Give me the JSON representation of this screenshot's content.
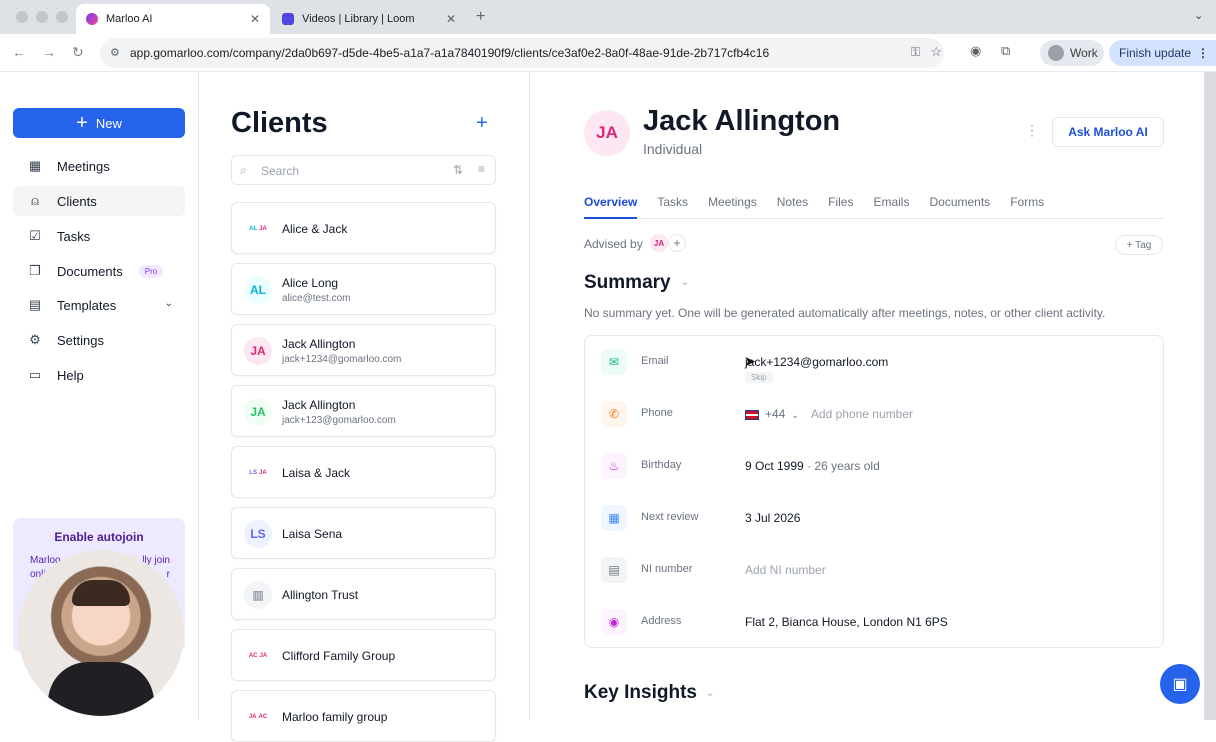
{
  "browser": {
    "tabs": [
      {
        "title": "Marloo AI",
        "active": true
      },
      {
        "title": "Videos | Library | Loom",
        "active": false
      }
    ],
    "url": "app.gomarloo.com/company/2da0b697-d5de-4be5-a1a7-a1a7840190f9/clients/ce3af0e2-8a0f-48ae-91de-2b717cfb4c16",
    "profile": "Work",
    "finish_update": "Finish update"
  },
  "sidebar": {
    "new_label": "New",
    "items": [
      {
        "label": "Meetings",
        "icon": "calendar-icon"
      },
      {
        "label": "Clients",
        "icon": "person-icon"
      },
      {
        "label": "Tasks",
        "icon": "checkbox-icon"
      },
      {
        "label": "Documents",
        "icon": "documents-icon",
        "badge": "Pro"
      },
      {
        "label": "Templates",
        "icon": "template-icon"
      },
      {
        "label": "Settings",
        "icon": "gear-icon"
      },
      {
        "label": "Help",
        "icon": "chat-icon"
      }
    ],
    "autojoin": {
      "title": "Enable autojoin",
      "desc_left": "Marloo",
      "desc_right": "lly join",
      "desc_line2_left": "onli",
      "desc_line2_right": "r"
    }
  },
  "clients": {
    "title": "Clients",
    "search_placeholder": "Search",
    "list": [
      {
        "name": "Alice & Jack",
        "email": "",
        "avatar": [
          "AL",
          "JA"
        ]
      },
      {
        "name": "Alice Long",
        "email": "alice@test.com",
        "avatar": [
          "AL"
        ]
      },
      {
        "name": "Jack Allington",
        "email": "jack+1234@gomarloo.com",
        "avatar": [
          "JA"
        ]
      },
      {
        "name": "Jack Allington",
        "email": "jack+123@gomarloo.com",
        "avatar": [
          "JA"
        ]
      },
      {
        "name": "Laisa & Jack",
        "email": "",
        "avatar": [
          "LS",
          "JA"
        ]
      },
      {
        "name": "Laisa Sena",
        "email": "",
        "avatar": [
          "LS"
        ]
      },
      {
        "name": "Allington Trust",
        "email": "",
        "avatar": []
      },
      {
        "name": "Clifford Family Group",
        "email": "",
        "avatar": [
          "AC",
          "JA"
        ]
      },
      {
        "name": "Marloo family group",
        "email": "",
        "avatar": [
          "JA",
          "AC"
        ]
      }
    ]
  },
  "detail": {
    "initials": "JA",
    "name": "Jack Allington",
    "type": "Individual",
    "ask_label": "Ask Marloo AI",
    "tabs": [
      "Overview",
      "Tasks",
      "Meetings",
      "Notes",
      "Files",
      "Emails",
      "Documents",
      "Forms"
    ],
    "advised_by": "Advised by",
    "advisor_initials": "JA",
    "tag_label": "+ Tag",
    "summary_title": "Summary",
    "summary_text": "No summary yet. One will be generated automatically after meetings, notes, or other client activity.",
    "fields": [
      {
        "label": "Email",
        "value": "jack+1234@gomarloo.com",
        "icon": "mail-icon"
      },
      {
        "label": "Phone",
        "code": "+44",
        "value": "Add phone number",
        "icon": "phone-icon"
      },
      {
        "label": "Birthday",
        "value": "9 Oct 1999",
        "extra": "· 26 years old",
        "icon": "cake-icon"
      },
      {
        "label": "Next review",
        "value": "3 Jul 2026",
        "icon": "calendar-icon"
      },
      {
        "label": "NI number",
        "value": "Add NI number",
        "icon": "id-card-icon"
      },
      {
        "label": "Address",
        "value": "Flat 2, Bianca House, London N1 6PS",
        "icon": "location-icon"
      }
    ],
    "skip_label": "Skip",
    "insights_title": "Key Insights"
  }
}
